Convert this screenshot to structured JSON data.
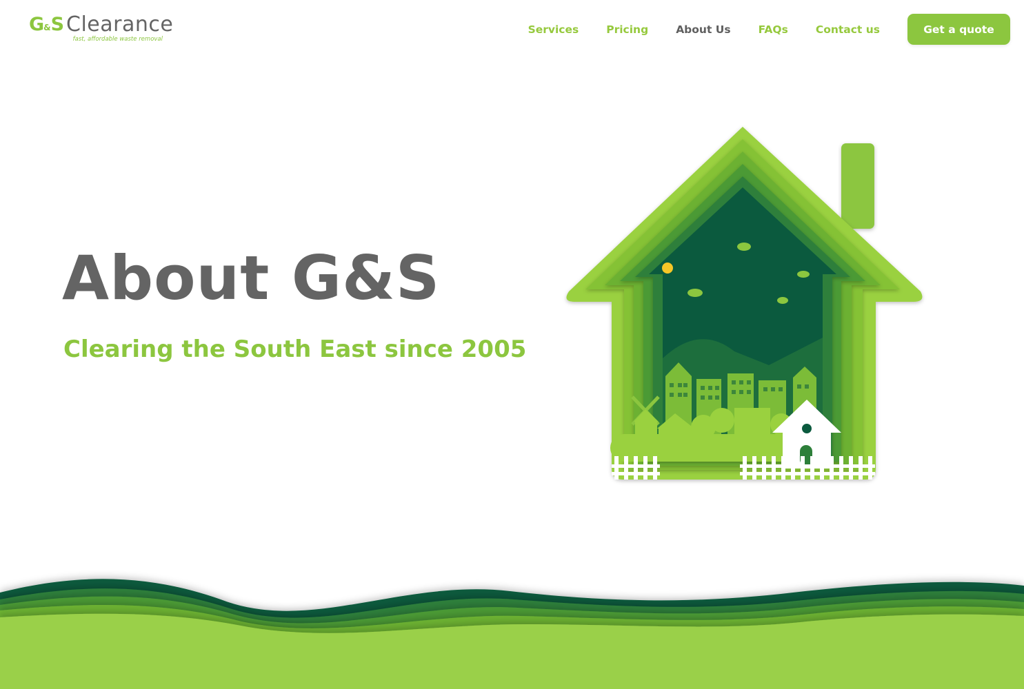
{
  "brand": {
    "gs": "G",
    "amp": "&",
    "gs2": "S",
    "name": "Clearance",
    "tagline": "fast, affordable waste removal"
  },
  "nav": {
    "items": [
      {
        "label": "Services"
      },
      {
        "label": "Pricing"
      },
      {
        "label": "About Us",
        "active": true
      },
      {
        "label": "FAQs"
      },
      {
        "label": "Contact us"
      }
    ],
    "cta": "Get a quote"
  },
  "hero": {
    "title": "About G&S",
    "subtitle": "Clearing the South East since 2005"
  },
  "colors": {
    "brand_green": "#8cc63f",
    "nav_green": "#96c93d",
    "text_gray": "#646464",
    "dark_green": "#0b5a3e"
  },
  "illustration": {
    "icon": "paper-cut-house-town-illustration"
  }
}
